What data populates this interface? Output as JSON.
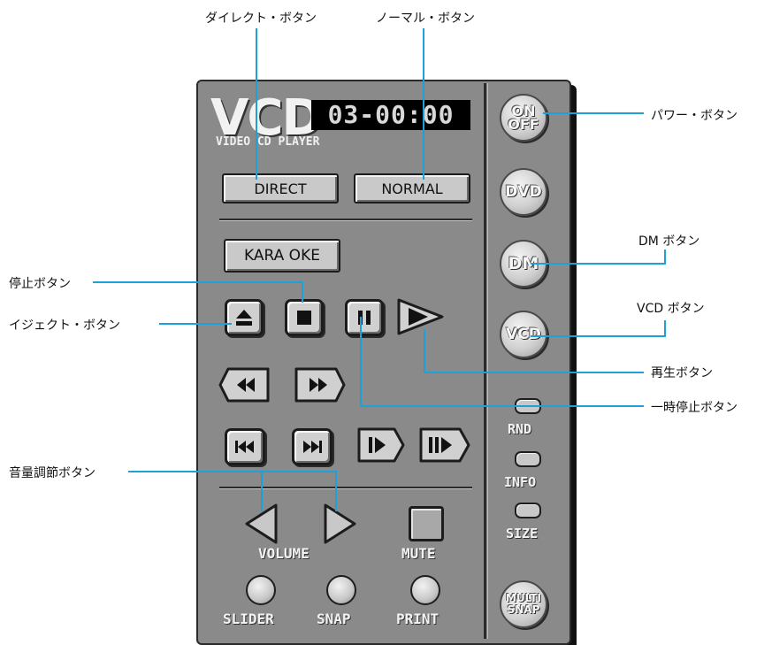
{
  "callouts": {
    "direct": "ダイレクト・ボタン",
    "normal": "ノーマル・ボタン",
    "power": "パワー・ボタン",
    "dm": "DM ボタン",
    "vcd": "VCD ボタン",
    "stop": "停止ボタン",
    "eject": "イジェクト・ボタン",
    "play": "再生ボタン",
    "pause": "一時停止ボタン",
    "volume": "音量調節ボタン"
  },
  "player": {
    "logo": "VCD",
    "subtitle": "VIDEO CD PLAYER",
    "display": "03-00:00",
    "direct_label": "DIRECT",
    "normal_label": "NORMAL",
    "karaoke_label": "KARA OKE",
    "volume_label": "VOLUME",
    "mute_label": "MUTE",
    "slider_label": "SLIDER",
    "snap_label": "SNAP",
    "print_label": "PRINT"
  },
  "side": {
    "power_label_1": "ON",
    "power_label_2": "OFF",
    "dvd_label": "DVD",
    "dm_label": "DM",
    "vcd_label": "VCD",
    "rnd_label": "RND",
    "info_label": "INFO",
    "size_label": "SIZE",
    "multisnap_label_1": "MULTI",
    "multisnap_label_2": "SNAP"
  },
  "colors": {
    "body": "#8a8a8a",
    "leader": "#1ea0d8",
    "display_bg": "#000000"
  }
}
